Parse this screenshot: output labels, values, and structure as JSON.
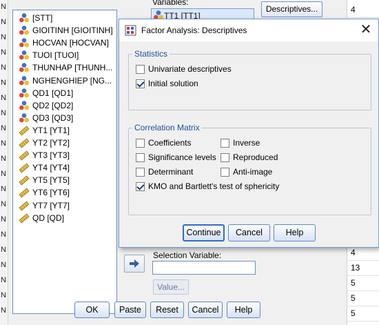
{
  "sheet": {
    "left_letter": "N",
    "right_values": [
      "4",
      "",
      "",
      "",
      "",
      "",
      "",
      "",
      "",
      "",
      "",
      "",
      "",
      "",
      "",
      "",
      "4",
      "13",
      "5",
      "5",
      "5"
    ]
  },
  "parent_dialog": {
    "variables_label": "Variables:",
    "selected_variable": "TT1 [TT1]",
    "descriptives_button": "Descriptives...",
    "selection_variable_label": "Selection Variable:",
    "value_button": "Value...",
    "buttons": {
      "ok": "OK",
      "paste": "Paste",
      "reset": "Reset",
      "cancel": "Cancel",
      "help": "Help"
    },
    "variable_list": [
      {
        "label": "[STT]",
        "icon": "nominal-icon"
      },
      {
        "label": "GIOITINH [GIOITINH]",
        "icon": "nominal-icon"
      },
      {
        "label": "HOCVAN [HOCVAN]",
        "icon": "nominal-icon"
      },
      {
        "label": "TUOI [TUOI]",
        "icon": "nominal-icon"
      },
      {
        "label": "THUNHAP [THUNH...",
        "icon": "nominal-icon"
      },
      {
        "label": "NGHENGHIEP [NG...",
        "icon": "nominal-icon"
      },
      {
        "label": "QD1 [QD1]",
        "icon": "nominal-icon"
      },
      {
        "label": "QD2 [QD2]",
        "icon": "nominal-icon"
      },
      {
        "label": "QD3 [QD3]",
        "icon": "nominal-icon"
      },
      {
        "label": "YT1 [YT1]",
        "icon": "scale-icon"
      },
      {
        "label": "YT2 [YT2]",
        "icon": "scale-icon"
      },
      {
        "label": "YT3 [YT3]",
        "icon": "scale-icon"
      },
      {
        "label": "YT4 [YT4]",
        "icon": "scale-icon"
      },
      {
        "label": "YT5 [YT5]",
        "icon": "scale-icon"
      },
      {
        "label": "YT6 [YT6]",
        "icon": "scale-icon"
      },
      {
        "label": "YT7 [YT7]",
        "icon": "scale-icon"
      },
      {
        "label": "QD [QD]",
        "icon": "scale-icon"
      }
    ]
  },
  "descriptives_dialog": {
    "title": "Factor Analysis: Descriptives",
    "close_glyph": "✕",
    "statistics": {
      "title": "Statistics",
      "univariate": {
        "label": "Univariate descriptives",
        "checked": false
      },
      "initial": {
        "label": "Initial solution",
        "checked": true
      }
    },
    "correlation_matrix": {
      "title": "Correlation Matrix",
      "coefficients": {
        "label": "Coefficients",
        "checked": false
      },
      "inverse": {
        "label": "Inverse",
        "checked": false
      },
      "significance": {
        "label": "Significance levels",
        "checked": false
      },
      "reproduced": {
        "label": "Reproduced",
        "checked": false
      },
      "determinant": {
        "label": "Determinant",
        "checked": false
      },
      "anti_image": {
        "label": "Anti-image",
        "checked": false
      },
      "kmo": {
        "label": "KMO and Bartlett's test of sphericity",
        "checked": true
      }
    },
    "buttons": {
      "continue": "Continue",
      "cancel": "Cancel",
      "help": "Help"
    }
  },
  "colors": {
    "accent": "#2f6cc9",
    "group_title": "#1f4f9a"
  }
}
